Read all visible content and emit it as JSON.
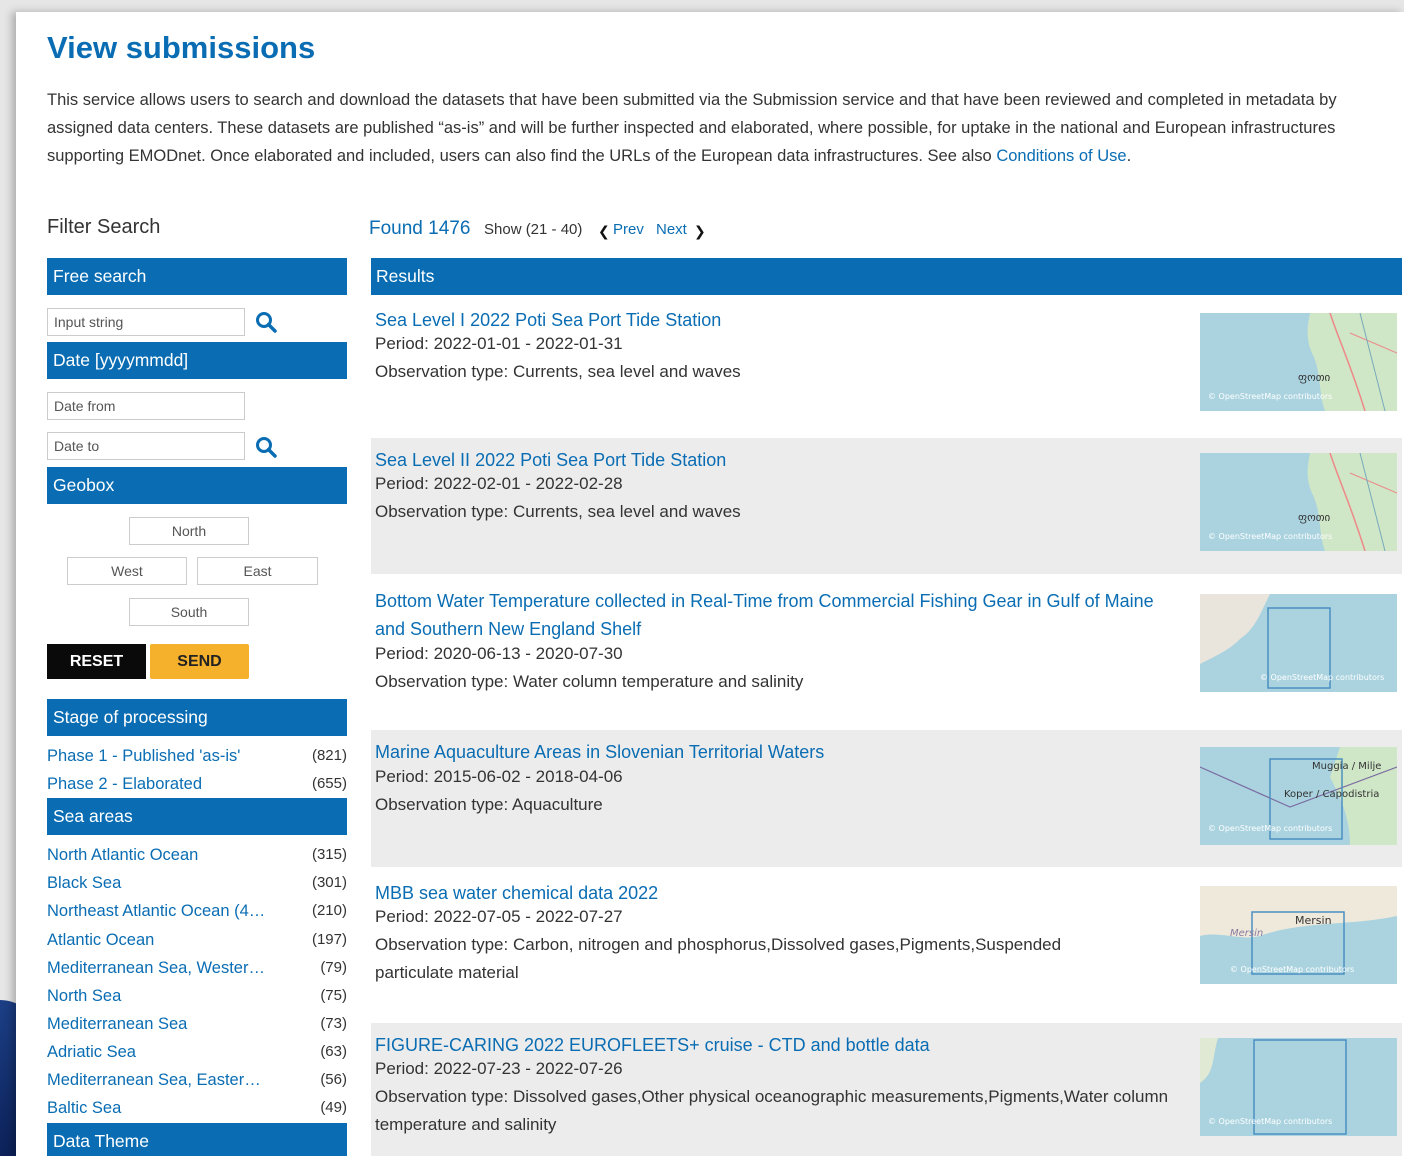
{
  "page": {
    "title": "View submissions",
    "intro_text": "This service allows users to search and download the datasets that have been submitted via the Submission service and that have been reviewed and completed in metadata by assigned data centers. These datasets are published “as-is” and will be further inspected and elaborated, where possible, for uptake in the national and European infrastructures supporting EMODnet. Once elaborated and included, users can also find the URLs of the European data infrastructures. See also ",
    "intro_link": "Conditions of Use",
    "intro_end": "."
  },
  "filter": {
    "title": "Filter Search",
    "free_search": {
      "header": "Free search",
      "placeholder": "Input string"
    },
    "date": {
      "header": "Date [yyyymmdd]",
      "from_placeholder": "Date from",
      "to_placeholder": "Date to"
    },
    "geobox": {
      "header": "Geobox",
      "north": "North",
      "west": "West",
      "east": "East",
      "south": "South"
    },
    "reset_label": "RESET",
    "send_label": "SEND",
    "stage": {
      "header": "Stage of processing",
      "items": [
        {
          "label": "Phase 1 - Published 'as-is'",
          "count": "(821)"
        },
        {
          "label": "Phase 2 - Elaborated",
          "count": "(655)"
        }
      ]
    },
    "sea_areas": {
      "header": "Sea areas",
      "items": [
        {
          "label": "North Atlantic Ocean",
          "count": "(315)"
        },
        {
          "label": "Black Sea",
          "count": "(301)"
        },
        {
          "label": "Northeast Atlantic Ocean (4…",
          "count": "(210)"
        },
        {
          "label": "Atlantic Ocean",
          "count": "(197)"
        },
        {
          "label": "Mediterranean Sea, Wester…",
          "count": "(79)"
        },
        {
          "label": "North Sea",
          "count": "(75)"
        },
        {
          "label": "Mediterranean Sea",
          "count": "(73)"
        },
        {
          "label": "Adriatic Sea",
          "count": "(63)"
        },
        {
          "label": "Mediterranean Sea, Easter…",
          "count": "(56)"
        },
        {
          "label": "Baltic Sea",
          "count": "(49)"
        }
      ]
    },
    "data_theme": {
      "header": "Data Theme"
    }
  },
  "results": {
    "found": "Found 1476",
    "show": "Show (21 - 40)",
    "prev": "Prev",
    "next": "Next",
    "header": "Results",
    "items": [
      {
        "title": "Sea Level I 2022 Poti Sea Port Tide Station",
        "period": "Period: 2022-01-01 - 2022-01-31",
        "obs": "Observation type: Currents, sea level and waves",
        "map_label": "ფოთი",
        "attribution": "© OpenStreetMap contributors"
      },
      {
        "title": "Sea Level II 2022 Poti Sea Port Tide Station",
        "period": "Period: 2022-02-01 - 2022-02-28",
        "obs": "Observation type: Currents, sea level and waves",
        "map_label": "ფოთი",
        "attribution": "© OpenStreetMap contributors"
      },
      {
        "title": "Bottom Water Temperature collected in Real-Time from Commercial Fishing Gear in Gulf of Maine and Southern New England Shelf",
        "period": "Period: 2020-06-13 - 2020-07-30",
        "obs": "Observation type: Water column temperature and salinity",
        "attribution": "© OpenStreetMap contributors"
      },
      {
        "title": "Marine Aquaculture Areas in Slovenian Territorial Waters",
        "period": "Period: 2015-06-02 - 2018-04-06",
        "obs": "Observation type: Aquaculture",
        "map_label": "Muggia / Milje",
        "map_label2": "Koper / Capodistria",
        "attribution": "© OpenStreetMap contributors"
      },
      {
        "title": "MBB sea water chemical data 2022",
        "period": "Period: 2022-07-05 - 2022-07-27",
        "obs": "Observation type: Carbon, nitrogen and phosphorus,Dissolved gases,Pigments,Suspended particulate material",
        "map_label": "Mersin",
        "map_label2": "Mersin",
        "attribution": "© OpenStreetMap contributors"
      },
      {
        "title": "FIGURE-CARING 2022 EUROFLEETS+ cruise - CTD and bottle data",
        "period": "Period: 2022-07-23 - 2022-07-26",
        "obs": "Observation type: Dissolved gases,Other physical oceanographic measurements,Pigments,Water column temperature and salinity",
        "attribution": "© OpenStreetMap contributors"
      }
    ]
  },
  "colors": {
    "primary": "#0a6db3",
    "send": "#f5b12c",
    "reset": "#0a0a0a",
    "alt_row": "#ececec"
  },
  "icons": {
    "search": "search-icon",
    "prev": "chevron-left-icon",
    "next": "chevron-right-icon"
  }
}
